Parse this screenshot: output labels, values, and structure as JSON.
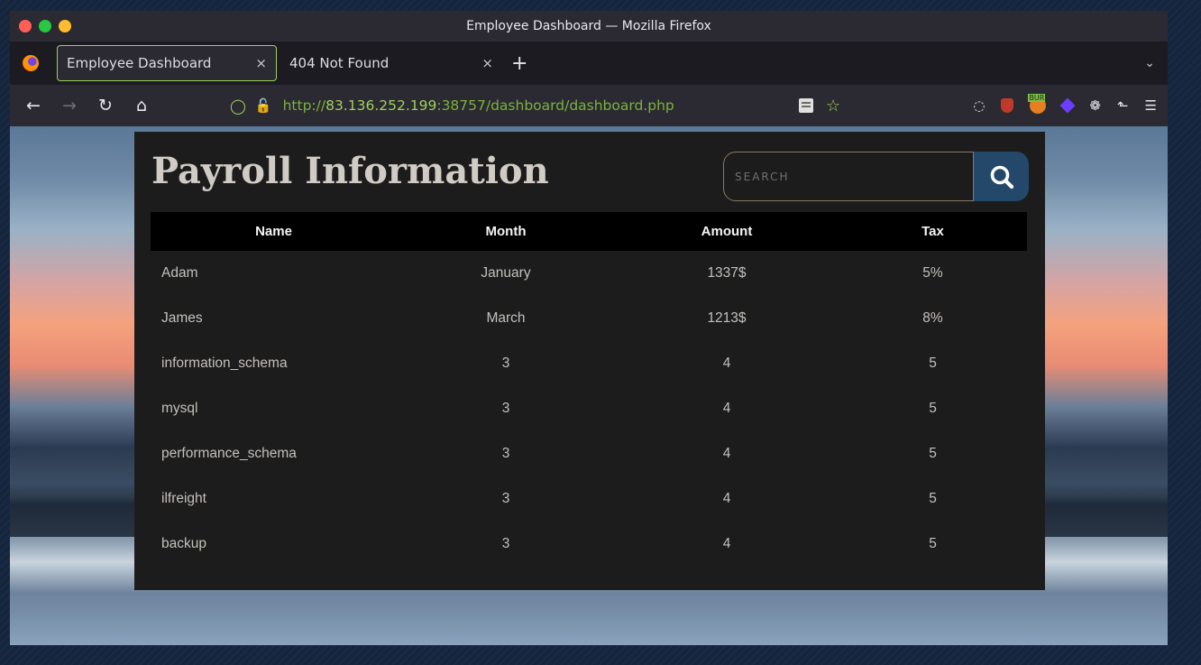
{
  "window": {
    "title": "Employee Dashboard — Mozilla Firefox"
  },
  "tabs": [
    {
      "label": "Employee Dashboard",
      "active": true
    },
    {
      "label": "404 Not Found",
      "active": false
    }
  ],
  "tab_close_glyph": "×",
  "newtab_glyph": "+",
  "address": {
    "scheme": "http://",
    "host": "83.136.252.199",
    "rest": ":38757/dashboard/dashboard.php"
  },
  "page": {
    "title": "Payroll Information",
    "search_placeholder": "SEARCH"
  },
  "table": {
    "headers": [
      "Name",
      "Month",
      "Amount",
      "Tax"
    ],
    "rows": [
      [
        "Adam",
        "January",
        "1337$",
        "5%"
      ],
      [
        "James",
        "March",
        "1213$",
        "8%"
      ],
      [
        "information_schema",
        "3",
        "4",
        "5"
      ],
      [
        "mysql",
        "3",
        "4",
        "5"
      ],
      [
        "performance_schema",
        "3",
        "4",
        "5"
      ],
      [
        "ilfreight",
        "3",
        "4",
        "5"
      ],
      [
        "backup",
        "3",
        "4",
        "5"
      ]
    ]
  },
  "colors": {
    "accent": "#9fd05a",
    "search_button": "#24486a",
    "panel_bg": "#1c1c1d"
  },
  "icons": {
    "back": "arrow-left-icon",
    "forward": "arrow-right-icon",
    "reload": "reload-icon",
    "home": "home-icon",
    "shield": "tracking-protection-icon",
    "lock": "insecure-lock-icon",
    "reader": "reader-view-icon",
    "bookmark": "star-icon",
    "search": "magnifier-icon"
  }
}
